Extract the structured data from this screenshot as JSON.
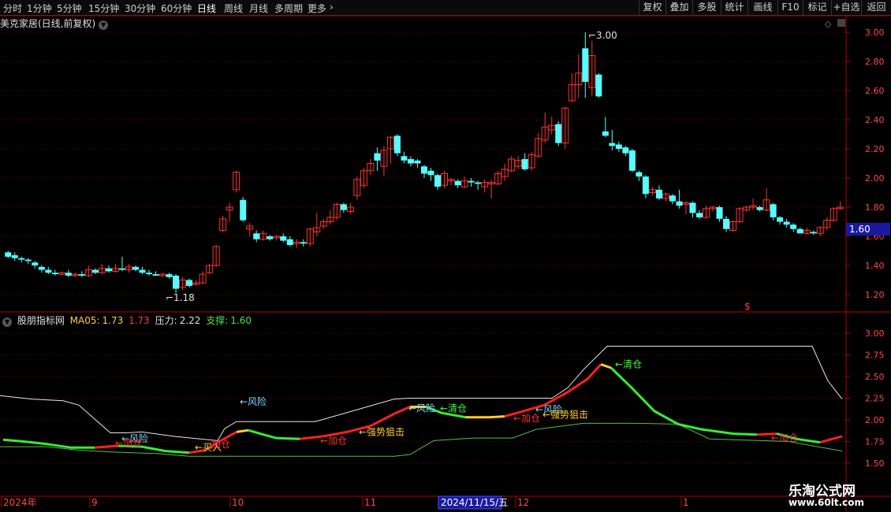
{
  "toolbar": {
    "periods": [
      "分时",
      "1分钟",
      "5分钟",
      "15分钟",
      "30分钟",
      "60分钟",
      "日线",
      "周线",
      "月线",
      "多周期",
      "更多"
    ],
    "active_period": "日线",
    "right_buttons": [
      "复权",
      "叠加",
      "多股",
      "统计",
      "画线",
      "F10",
      "标记",
      "+自选",
      "返回"
    ]
  },
  "main_chart": {
    "title": "美克家居(日线,前复权)",
    "price_ticks": [
      "3.00",
      "2.80",
      "2.60",
      "2.40",
      "2.20",
      "2.00",
      "1.80",
      "1.60",
      "1.40",
      "1.20"
    ],
    "current_price": "1.60",
    "high_marker": "3.00",
    "low_marker": "1.18",
    "dollar_marker": "$"
  },
  "indicator": {
    "name": "股朋指标网",
    "ma_label": "MA05:",
    "ma_val1": "1.73",
    "ma_val2": "1.73",
    "pressure_label": "压力:",
    "pressure_val": "2.22",
    "support_label": "支撑:",
    "support_val": "1.60",
    "ticks": [
      "3.00",
      "2.75",
      "2.50",
      "2.25",
      "2.00",
      "1.75",
      "1.50"
    ],
    "annotations": [
      {
        "text": "←风险",
        "color": "#7fd6ff",
        "price": 1.78
      },
      {
        "text": "←加仓",
        "color": "#ff3030",
        "price": 1.73
      },
      {
        "text": "←买入",
        "color": "#ffd02a",
        "price": 1.68
      },
      {
        "text": "加仓",
        "color": "#ff3030",
        "price": 1.72
      },
      {
        "text": "←风险",
        "color": "#7fd6ff",
        "price": 2.21
      },
      {
        "text": "←加仓",
        "color": "#ff3030",
        "price": 1.76
      },
      {
        "text": "←强势狙击",
        "color": "#ffd02a",
        "price": 1.86
      },
      {
        "text": "←风险",
        "color": "#7fd6ff",
        "price": 2.13
      },
      {
        "text": "←清仓",
        "color": "#3cff3c",
        "price": 2.13
      },
      {
        "text": "←加仓",
        "color": "#ff3030",
        "price": 2.02
      },
      {
        "text": "←风险",
        "color": "#7fd6ff",
        "price": 2.12
      },
      {
        "text": "←强势狙击",
        "color": "#ffd02a",
        "price": 2.06
      },
      {
        "text": "←清仓",
        "color": "#3cff3c",
        "price": 2.64
      },
      {
        "text": "←加仓",
        "color": "#ff3030",
        "price": 1.79
      }
    ]
  },
  "time_axis": {
    "labels": [
      "2024年",
      "9",
      "10",
      "11",
      "12",
      "1"
    ],
    "cursor_date": "2024/11/15/五"
  },
  "watermark": {
    "title": "乐淘公式网",
    "url": "www.60lt.com"
  },
  "colors": {
    "up": "#ff3232",
    "down": "#54ffff",
    "grid": "#7a0000",
    "axis": "#b00000",
    "ma_yellow": "#ffd02a",
    "ma_green": "#33ee33",
    "ma_red": "#ff2020",
    "pressure": "#e8e8e8",
    "support": "#50c050"
  }
}
